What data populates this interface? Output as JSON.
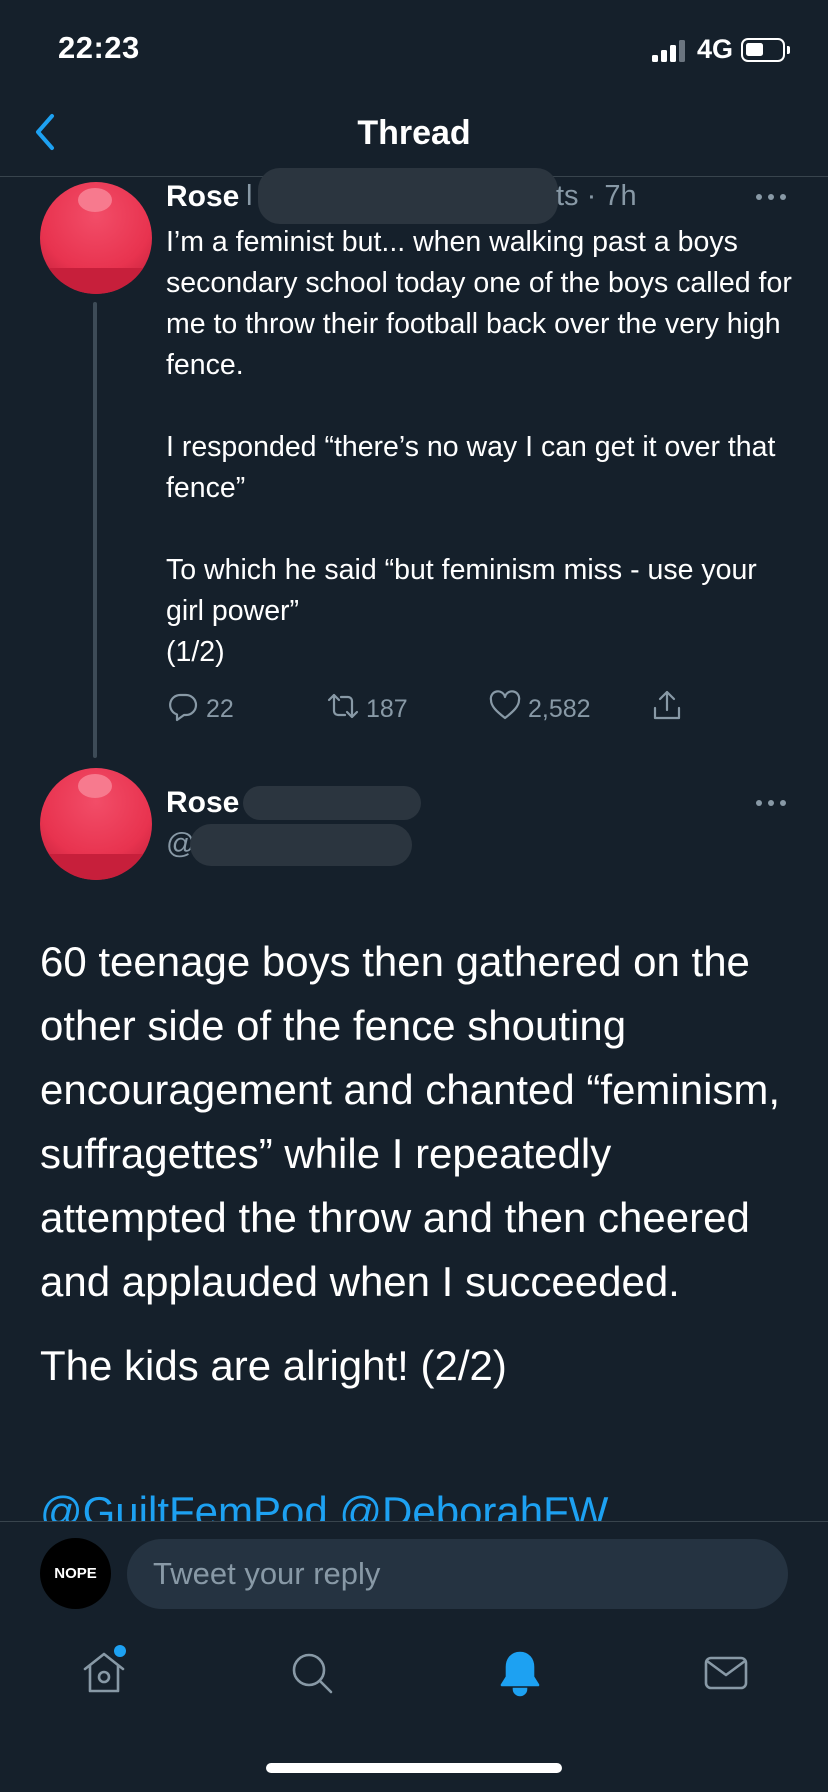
{
  "status_bar": {
    "time": "22:23",
    "network": "4G"
  },
  "nav": {
    "title": "Thread"
  },
  "tweet1": {
    "name": "Rose",
    "name_trail": "l",
    "meta_tail": "ts · 7h",
    "paragraphs": [
      "I’m a feminist but... when walking past a boys secondary school today one of the boys called for me to throw their football back over the very high fence.",
      "I responded “there’s no way I can get it over that fence”",
      "To which he said “but feminism miss - use your girl power”\n(1/2)"
    ],
    "replies": "22",
    "retweets": "187",
    "likes": "2,582"
  },
  "tweet2": {
    "name": "Rose",
    "handle_prefix": "@",
    "paragraphs": [
      "60 teenage boys then gathered on the other side of the fence shouting encouragement and chanted “feminism, suffragettes” while I repeatedly attempted the throw and then cheered and applauded when I succeeded.",
      "The kids are alright! (2/2)"
    ],
    "mentions": "@GuiltFemPod @DeborahFW"
  },
  "reply": {
    "avatar_label": "NOPE",
    "placeholder": "Tweet your reply"
  },
  "colors": {
    "background": "#15202b",
    "accent": "#1da1f2",
    "secondary_text": "#8899a6",
    "avatar": "#e8334f"
  },
  "icons": [
    "back-chevron-icon",
    "more-dots-icon",
    "reply-icon",
    "retweet-icon",
    "like-icon",
    "share-icon",
    "home-icon",
    "search-icon",
    "notifications-icon",
    "messages-icon"
  ]
}
